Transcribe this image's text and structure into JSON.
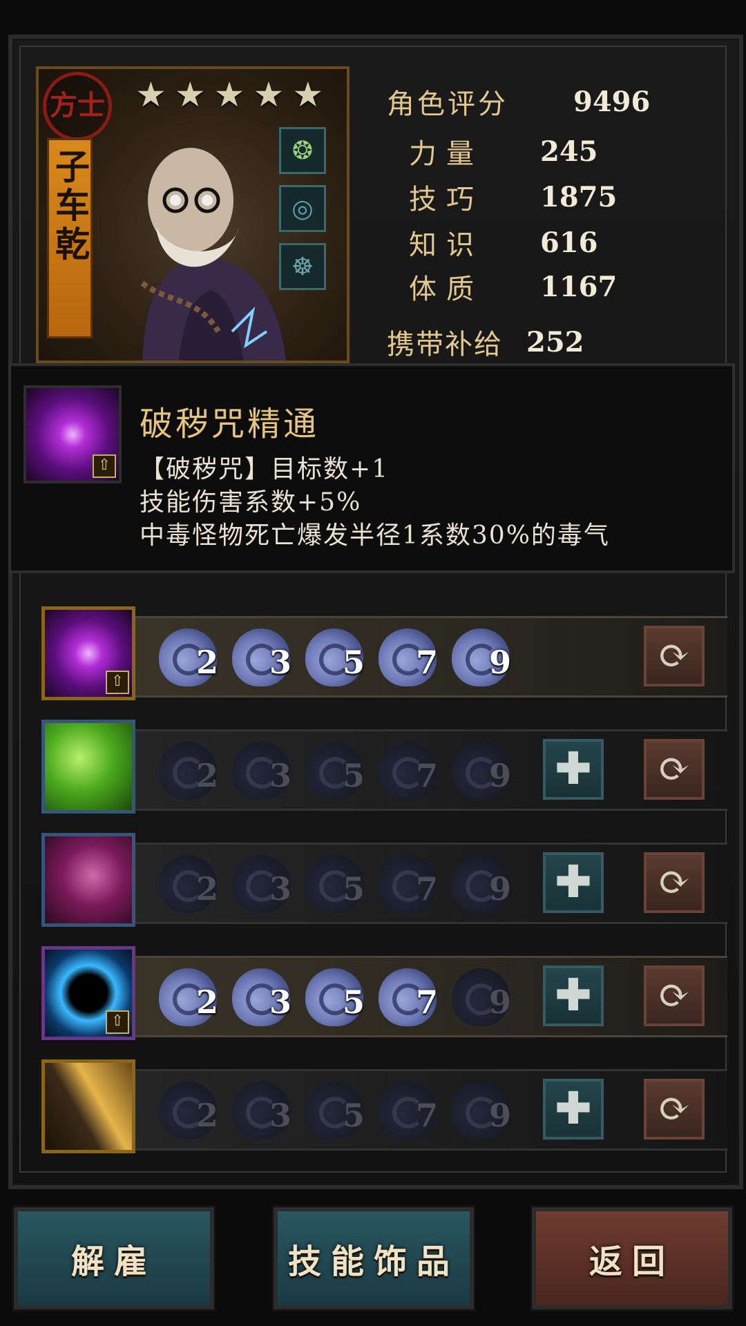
{
  "hero": {
    "class_label": "方士",
    "name": "子车乾",
    "stars": 5,
    "star_glyph": "★",
    "trinket_slots": [
      {
        "icon": "green-orb-trinket-icon",
        "glyph": "❂",
        "color": "#9ad07a"
      },
      {
        "icon": "teal-swirl-trinket-icon",
        "glyph": "◎",
        "color": "#5f9ea8"
      },
      {
        "icon": "teal-figure-trinket-icon",
        "glyph": "☸",
        "color": "#6fa3a8"
      }
    ]
  },
  "stats": {
    "score": {
      "label": "角色评分",
      "value": "9496"
    },
    "strength": {
      "label": "力量",
      "value": "245"
    },
    "skill": {
      "label": "技巧",
      "value": "1875"
    },
    "knowledge": {
      "label": "知识",
      "value": "616"
    },
    "constitution": {
      "label": "体质",
      "value": "1167"
    },
    "supplies": {
      "label": "携带补给",
      "value": "252"
    }
  },
  "tooltip": {
    "icon": "purple-vortex-skill-icon",
    "title": "破秽咒精通",
    "lines": [
      "【破秽咒】目标数+1",
      "技能伤害系数+5%",
      "中毒怪物死亡爆发半径1系数30%的毒气"
    ]
  },
  "skills": [
    {
      "icon": "purple-vortex-skill-icon",
      "frame": "gold",
      "upgraded": true,
      "levels": [
        "2",
        "3",
        "5",
        "7",
        "9"
      ],
      "unlocked": 5,
      "show_plus": false
    },
    {
      "icon": "green-fist-skill-icon",
      "frame": "blue",
      "upgraded": false,
      "levels": [
        "2",
        "3",
        "5",
        "7",
        "9"
      ],
      "unlocked": 0,
      "show_plus": true
    },
    {
      "icon": "crimson-grab-skill-icon",
      "frame": "blue",
      "upgraded": false,
      "levels": [
        "2",
        "3",
        "5",
        "7",
        "9"
      ],
      "unlocked": 0,
      "show_plus": true
    },
    {
      "icon": "lightning-orb-skill-icon",
      "frame": "purple",
      "upgraded": true,
      "levels": [
        "2",
        "3",
        "5",
        "7",
        "9"
      ],
      "unlocked": 4,
      "show_plus": true
    },
    {
      "icon": "golden-slash-skill-icon",
      "frame": "gold",
      "upgraded": false,
      "levels": [
        "2",
        "3",
        "5",
        "7",
        "9"
      ],
      "unlocked": 0,
      "show_plus": true
    }
  ],
  "buttons": {
    "plus_glyph": "✚",
    "swap_glyph": "⟳",
    "upgrade_glyph": "⇧",
    "dismiss": "解雇",
    "trinkets": "技能饰品",
    "back": "返回"
  }
}
